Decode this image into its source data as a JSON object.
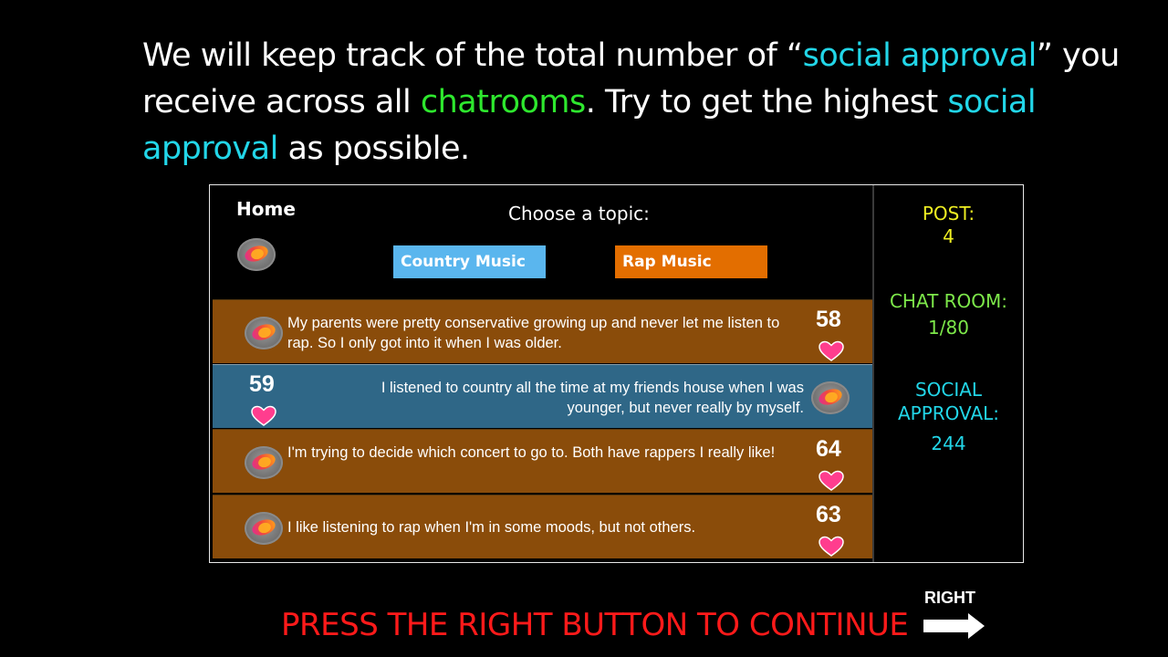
{
  "instructions": {
    "part1": "We will keep track of the total number of “",
    "social1": "social approval",
    "part2": "” you receive across all ",
    "chatrooms": "chatrooms",
    "part3": ". Try to get the highest ",
    "social2": "social approval",
    "part4": " as possible."
  },
  "home": {
    "label": "Home"
  },
  "topics": {
    "prompt": "Choose a topic:",
    "options": [
      "Country Music",
      "Rap Music"
    ]
  },
  "posts": [
    {
      "text": "My parents were pretty conservative growing up and never let me listen to rap. So I only got into it when I was older.",
      "likes": "58",
      "author": "other"
    },
    {
      "text": "I listened to country all the time at my friends house when I was younger, but never really by myself.",
      "likes": "59",
      "author": "self"
    },
    {
      "text": "I'm trying to decide which concert to go to. Both have rappers I really like!",
      "likes": "64",
      "author": "other"
    },
    {
      "text": "I like listening to rap when I'm in some moods, but not others.",
      "likes": "63",
      "author": "other"
    }
  ],
  "status": {
    "post_label": "POST:",
    "post_value": "4",
    "room_label": "CHAT ROOM:",
    "room_value": "1/80",
    "approval_label_line1": "SOCIAL",
    "approval_label_line2": "APPROVAL:",
    "approval_value": "244"
  },
  "footer": {
    "continue_text": "PRESS THE RIGHT BUTTON TO CONTINUE",
    "right_label": "RIGHT"
  },
  "colors": {
    "background": "#000000",
    "accent_cyan": "#22d6e8",
    "accent_green": "#2ee82e",
    "post_other_bg": "#8a4c0a",
    "post_self_bg": "#2f6787",
    "country_button": "#5ab6ee",
    "rap_button": "#e36e00",
    "heart": "#ff3d8e",
    "continue_red": "#ff1a1a",
    "post_counter_yellow": "#eeee22"
  },
  "icons": {
    "avatar": "avatar-icon",
    "like": "heart-icon",
    "continue": "right-arrow-icon"
  }
}
